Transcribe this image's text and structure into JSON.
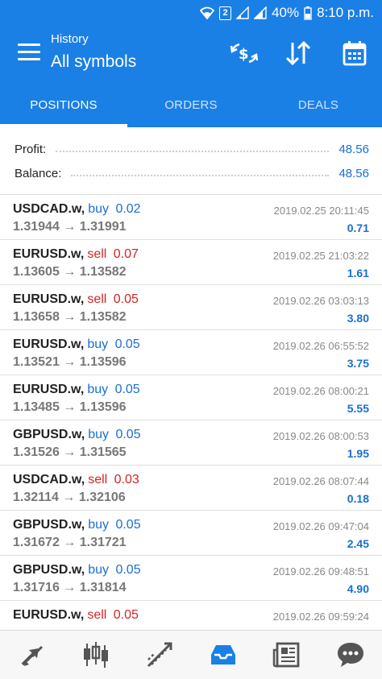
{
  "status_bar": {
    "sim_badge": "2",
    "battery": "40%",
    "time": "8:10 p.m."
  },
  "header": {
    "subtitle": "History",
    "title": "All symbols"
  },
  "tabs": [
    {
      "label": "POSITIONS",
      "active": true
    },
    {
      "label": "ORDERS",
      "active": false
    },
    {
      "label": "DEALS",
      "active": false
    }
  ],
  "summary": {
    "profit_label": "Profit:",
    "profit_value": "48.56",
    "balance_label": "Balance:",
    "balance_value": "48.56"
  },
  "deals": [
    {
      "symbol": "USDCAD.w,",
      "type": "buy",
      "volume": "0.02",
      "prices": "1.31944 → 1.31991",
      "time": "2019.02.25 20:11:45",
      "profit": "0.71"
    },
    {
      "symbol": "EURUSD.w,",
      "type": "sell",
      "volume": "0.07",
      "prices": "1.13605 → 1.13582",
      "time": "2019.02.25 21:03:22",
      "profit": "1.61"
    },
    {
      "symbol": "EURUSD.w,",
      "type": "sell",
      "volume": "0.05",
      "prices": "1.13658 → 1.13582",
      "time": "2019.02.26 03:03:13",
      "profit": "3.80"
    },
    {
      "symbol": "EURUSD.w,",
      "type": "buy",
      "volume": "0.05",
      "prices": "1.13521 → 1.13596",
      "time": "2019.02.26 06:55:52",
      "profit": "3.75"
    },
    {
      "symbol": "EURUSD.w,",
      "type": "buy",
      "volume": "0.05",
      "prices": "1.13485 → 1.13596",
      "time": "2019.02.26 08:00:21",
      "profit": "5.55"
    },
    {
      "symbol": "GBPUSD.w,",
      "type": "buy",
      "volume": "0.05",
      "prices": "1.31526 → 1.31565",
      "time": "2019.02.26 08:00:53",
      "profit": "1.95"
    },
    {
      "symbol": "USDCAD.w,",
      "type": "sell",
      "volume": "0.03",
      "prices": "1.32114 → 1.32106",
      "time": "2019.02.26 08:07:44",
      "profit": "0.18"
    },
    {
      "symbol": "GBPUSD.w,",
      "type": "buy",
      "volume": "0.05",
      "prices": "1.31672 → 1.31721",
      "time": "2019.02.26 09:47:04",
      "profit": "2.45"
    },
    {
      "symbol": "GBPUSD.w,",
      "type": "buy",
      "volume": "0.05",
      "prices": "1.31716 → 1.31814",
      "time": "2019.02.26 09:48:51",
      "profit": "4.90"
    },
    {
      "symbol": "EURUSD.w,",
      "type": "sell",
      "volume": "0.05",
      "prices": "",
      "time": "2019.02.26 09:59:24",
      "profit": ""
    }
  ],
  "bottom_nav": [
    {
      "name": "quotes-icon"
    },
    {
      "name": "chart-icon"
    },
    {
      "name": "trade-icon"
    },
    {
      "name": "history-icon",
      "active": true
    },
    {
      "name": "news-icon"
    },
    {
      "name": "chat-icon"
    }
  ],
  "colors": {
    "primary": "#1a80e6",
    "buy": "#1a6fd1",
    "sell": "#d32424",
    "active_nav": "#1a80e6",
    "inactive_nav": "#555555"
  }
}
